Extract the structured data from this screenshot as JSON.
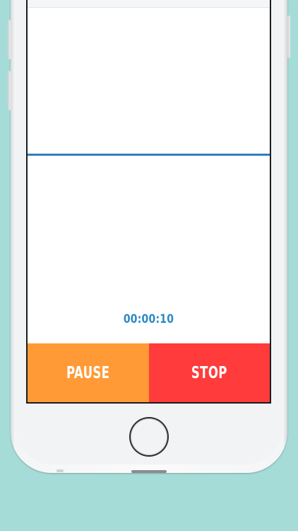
{
  "recorder": {
    "timer": "00:00:10",
    "pause_label": "PAUSE",
    "stop_label": "STOP"
  },
  "colors": {
    "background": "#a6dcd7",
    "pause_button": "#ff9a36",
    "stop_button": "#ff3b3b",
    "timer_text": "#2d88c6",
    "level_line": "#2f7fc3"
  },
  "icons": {
    "device": "phone-icon",
    "home": "home-button"
  }
}
